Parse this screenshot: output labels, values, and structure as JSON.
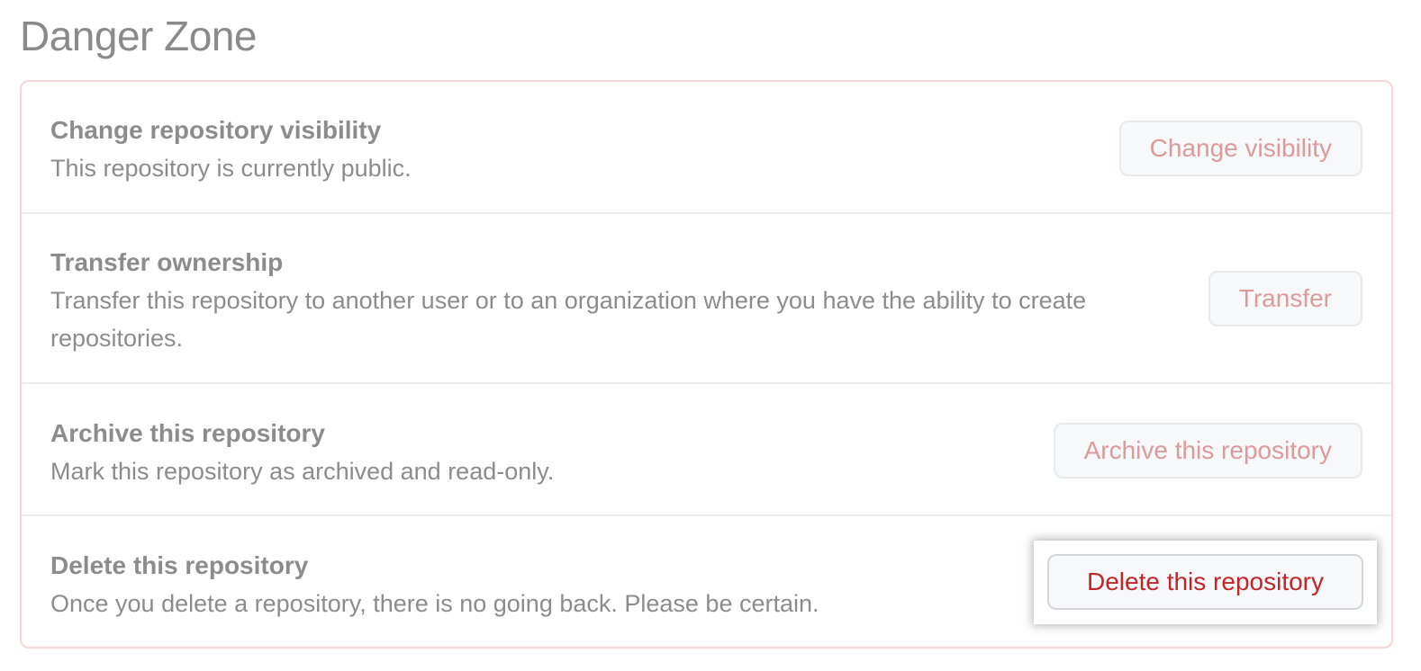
{
  "page": {
    "title": "Danger Zone"
  },
  "rows": [
    {
      "title": "Change repository visibility",
      "description": "This repository is currently public.",
      "button": "Change visibility"
    },
    {
      "title": "Transfer ownership",
      "description_line1": "Transfer this repository to another user or to an organization where you have the ability to create",
      "description_line2": "repositories.",
      "button": "Transfer"
    },
    {
      "title": "Archive this repository",
      "description": "Mark this repository as archived and read-only.",
      "button": "Archive this repository"
    },
    {
      "title": "Delete this repository",
      "description": "Once you delete a repository, there is no going back. Please be certain.",
      "button": "Delete this repository"
    }
  ],
  "colors": {
    "danger_border": "#f6d6d6",
    "danger_text_active": "#c2252a",
    "danger_text_muted": "#dc9a9a",
    "muted_text": "#8c8c8c"
  }
}
